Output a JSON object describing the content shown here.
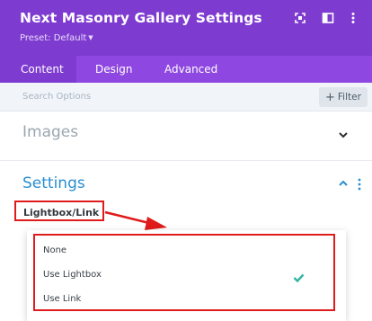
{
  "header": {
    "title": "Next Masonry Gallery Settings",
    "preset": "Preset: Default"
  },
  "icons": {
    "expand": "expand-icon",
    "sidebar": "sidebar-layout-icon",
    "more": "more-vertical-icon",
    "caret": "caret-down-icon",
    "chevron_down": "chevron-down-icon",
    "chevron_up": "chevron-up-icon",
    "check": "check-icon"
  },
  "tabs": [
    {
      "label": "Content",
      "active": true
    },
    {
      "label": "Design",
      "active": false
    },
    {
      "label": "Advanced",
      "active": false
    }
  ],
  "search": {
    "placeholder": "Search Options",
    "filter_label": "Filter",
    "filter_icon": "+"
  },
  "sections": [
    {
      "title": "Images",
      "expanded": false
    },
    {
      "title": "Settings",
      "expanded": true
    }
  ],
  "field": {
    "label": "Lightbox/Link",
    "options": [
      {
        "label": "None",
        "selected": false
      },
      {
        "label": "Use Lightbox",
        "selected": true
      },
      {
        "label": "Use Link",
        "selected": false
      }
    ]
  },
  "colors": {
    "header_bg": "#7e3bd0",
    "tabs_bg": "#8e47e0",
    "accent_blue": "#2a8ed0",
    "check_green": "#2fb6a0",
    "annotation_red": "#e01b1b"
  }
}
